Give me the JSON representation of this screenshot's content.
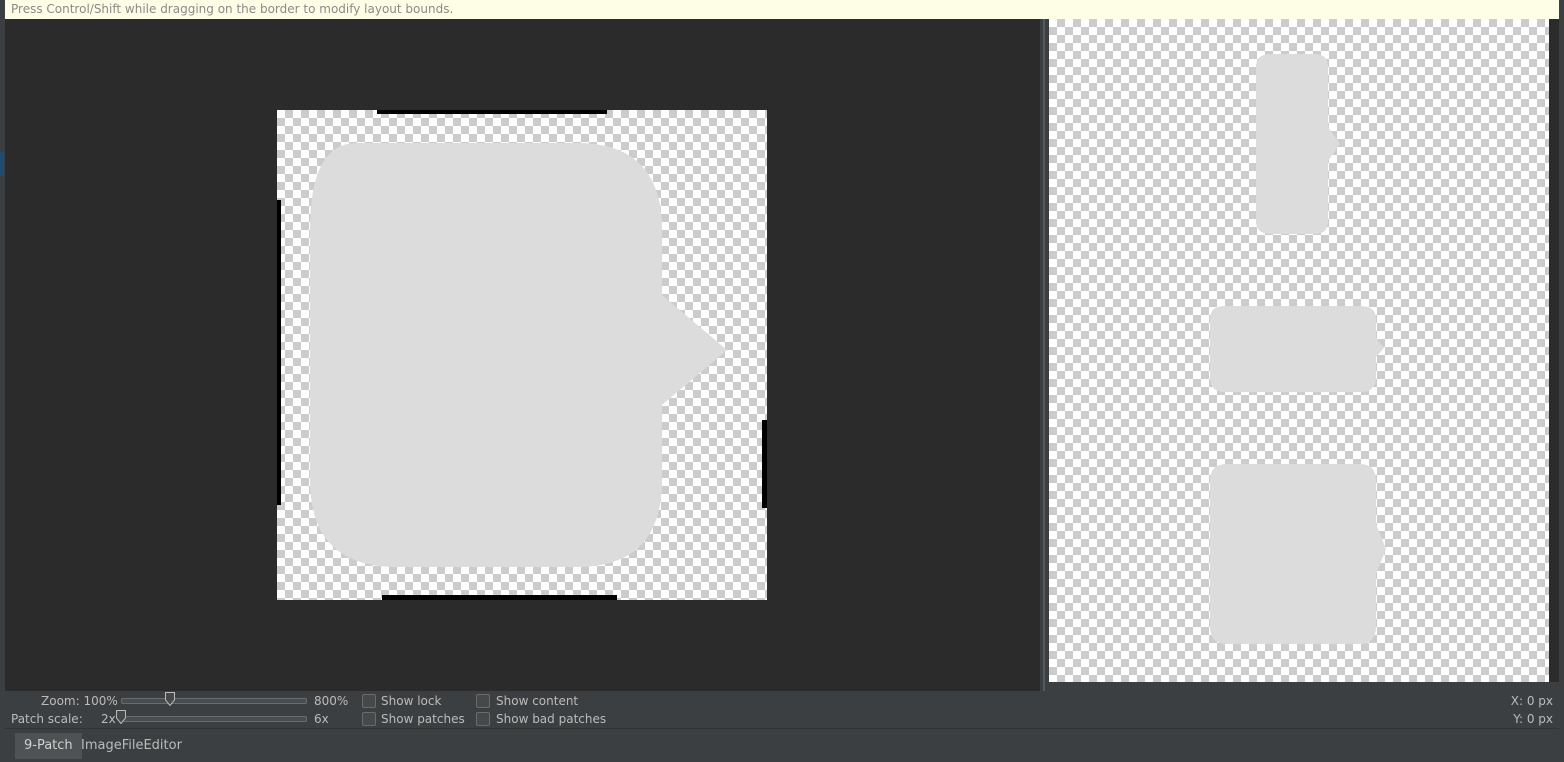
{
  "hint": "Press Control/Shift while dragging on the border to modify layout bounds.",
  "controls": {
    "zoom_label": "Zoom: 100%",
    "zoom_max": "800%",
    "zoom_value_percent": 100,
    "patch_scale_label": "Patch scale:",
    "patch_scale_min": "2x",
    "patch_scale_max": "6x",
    "patch_scale_value": 2,
    "show_lock": "Show lock",
    "show_patches": "Show patches",
    "show_content": "Show content",
    "show_bad_patches": "Show bad patches",
    "coord_x": "X: 0 px",
    "coord_y": "Y: 0 px"
  },
  "tabs": [
    {
      "label": "9-Patch",
      "active": true
    },
    {
      "label": "ImageFileEditor",
      "active": false
    }
  ],
  "colors": {
    "bubble": "#dcdcdc",
    "marker": "#000000",
    "background": "#2b2b2b",
    "panel": "#3c3f41"
  }
}
